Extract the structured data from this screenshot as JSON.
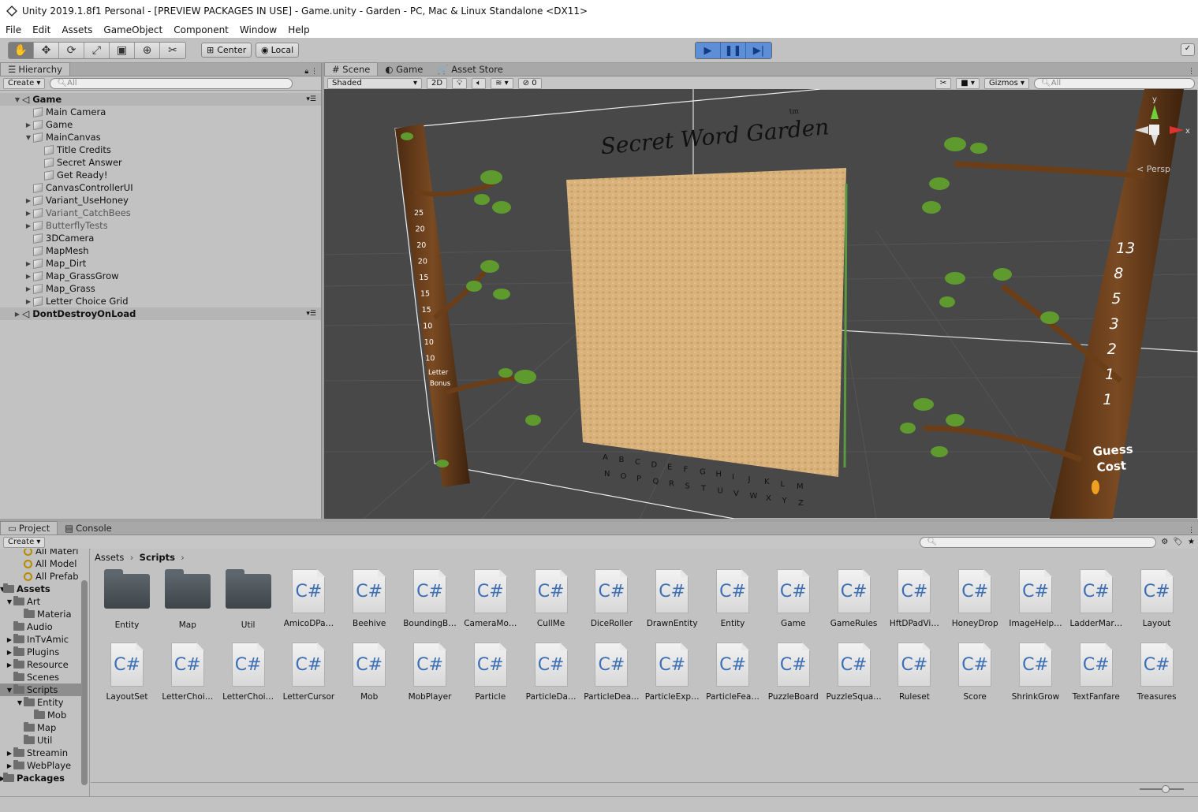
{
  "window": {
    "title": "Unity 2019.1.8f1 Personal - [PREVIEW PACKAGES IN USE] - Game.unity - Garden - PC, Mac & Linux Standalone <DX11>"
  },
  "menu": [
    "File",
    "Edit",
    "Assets",
    "GameObject",
    "Component",
    "Window",
    "Help"
  ],
  "toolbar": {
    "tools": [
      "hand-tool",
      "move-tool",
      "rotate-tool",
      "scale-tool",
      "rect-tool",
      "transform-tool",
      "custom-tool"
    ],
    "pivot_mode": "Center",
    "pivot_rotation": "Local"
  },
  "hierarchy": {
    "tab": "Hierarchy",
    "create": "Create",
    "search_placeholder": "All",
    "items": [
      {
        "label": "Game",
        "indent": 0,
        "arrow": "down",
        "scene": true
      },
      {
        "label": "Main Camera",
        "indent": 1,
        "arrow": ""
      },
      {
        "label": "Game",
        "indent": 1,
        "arrow": "right"
      },
      {
        "label": "MainCanvas",
        "indent": 1,
        "arrow": "down"
      },
      {
        "label": "Title Credits",
        "indent": 2,
        "arrow": ""
      },
      {
        "label": "Secret Answer",
        "indent": 2,
        "arrow": ""
      },
      {
        "label": "Get Ready!",
        "indent": 2,
        "arrow": ""
      },
      {
        "label": "CanvasControllerUI",
        "indent": 1,
        "arrow": ""
      },
      {
        "label": "Variant_UseHoney",
        "indent": 1,
        "arrow": "right"
      },
      {
        "label": "Variant_CatchBees",
        "indent": 1,
        "arrow": "right",
        "dim": true
      },
      {
        "label": "ButterflyTests",
        "indent": 1,
        "arrow": "right",
        "dim": true
      },
      {
        "label": "3DCamera",
        "indent": 1,
        "arrow": ""
      },
      {
        "label": "MapMesh",
        "indent": 1,
        "arrow": ""
      },
      {
        "label": "Map_Dirt",
        "indent": 1,
        "arrow": "right"
      },
      {
        "label": "Map_GrassGrow",
        "indent": 1,
        "arrow": "right"
      },
      {
        "label": "Map_Grass",
        "indent": 1,
        "arrow": "right"
      },
      {
        "label": "Letter Choice Grid",
        "indent": 1,
        "arrow": "right"
      },
      {
        "label": "DontDestroyOnLoad",
        "indent": 0,
        "arrow": "right",
        "scene": true
      }
    ]
  },
  "scene_tabs": [
    {
      "label": "Scene",
      "icon": "#"
    },
    {
      "label": "Game",
      "icon": "◐"
    },
    {
      "label": "Asset Store",
      "icon": "🛒"
    }
  ],
  "scene_toolbar": {
    "shading": "Shaded",
    "mode_2d": "2D",
    "hidden_count": "0",
    "gizmos": "Gizmos",
    "search_placeholder": "All"
  },
  "scene": {
    "title": "Secret Word Garden",
    "trademark": "tm",
    "left_scores": [
      "25",
      "20",
      "20",
      "20",
      "15",
      "15",
      "15",
      "10",
      "10",
      "10"
    ],
    "left_caption": [
      "Letter",
      "Bonus"
    ],
    "right_costs": [
      "13",
      "8",
      "5",
      "3",
      "2",
      "1",
      "1"
    ],
    "right_caption": [
      "Guess",
      "Cost"
    ],
    "letters_row1": [
      "A",
      "B",
      "C",
      "D",
      "E",
      "F",
      "G",
      "H",
      "I",
      "J",
      "K",
      "L",
      "M"
    ],
    "letters_row2": [
      "N",
      "O",
      "P",
      "Q",
      "R",
      "S",
      "T",
      "U",
      "V",
      "W",
      "X",
      "Y",
      "Z"
    ],
    "gizmo": {
      "x": "x",
      "y": "y",
      "persp": "< Persp"
    }
  },
  "project": {
    "tabs": [
      "Project",
      "Console"
    ],
    "create": "Create",
    "breadcrumb": [
      "Assets",
      "Scripts"
    ],
    "tree": [
      {
        "label": "All Materi",
        "indent": 2,
        "icon": "search",
        "arrow": ""
      },
      {
        "label": "All Model",
        "indent": 2,
        "icon": "search",
        "arrow": ""
      },
      {
        "label": "All Prefab",
        "indent": 2,
        "icon": "search",
        "arrow": ""
      },
      {
        "label": "Assets",
        "indent": 0,
        "icon": "folder",
        "arrow": "down",
        "bold": true
      },
      {
        "label": "Art",
        "indent": 1,
        "icon": "folder",
        "arrow": "down"
      },
      {
        "label": "Materia",
        "indent": 2,
        "icon": "folder",
        "arrow": ""
      },
      {
        "label": "Audio",
        "indent": 1,
        "icon": "folder",
        "arrow": ""
      },
      {
        "label": "InTvAmic",
        "indent": 1,
        "icon": "folder",
        "arrow": "right"
      },
      {
        "label": "Plugins",
        "indent": 1,
        "icon": "folder",
        "arrow": "right"
      },
      {
        "label": "Resource",
        "indent": 1,
        "icon": "folder",
        "arrow": "right"
      },
      {
        "label": "Scenes",
        "indent": 1,
        "icon": "folder",
        "arrow": ""
      },
      {
        "label": "Scripts",
        "indent": 1,
        "icon": "folder",
        "arrow": "down",
        "selected": true
      },
      {
        "label": "Entity",
        "indent": 2,
        "icon": "folder",
        "arrow": "down"
      },
      {
        "label": "Mob",
        "indent": 3,
        "icon": "folder",
        "arrow": ""
      },
      {
        "label": "Map",
        "indent": 2,
        "icon": "folder",
        "arrow": ""
      },
      {
        "label": "Util",
        "indent": 2,
        "icon": "folder",
        "arrow": ""
      },
      {
        "label": "Streamin",
        "indent": 1,
        "icon": "folder",
        "arrow": "right"
      },
      {
        "label": "WebPlaye",
        "indent": 1,
        "icon": "folder",
        "arrow": "right"
      },
      {
        "label": "Packages",
        "indent": 0,
        "icon": "folder",
        "arrow": "right",
        "bold": true
      }
    ],
    "assets": [
      {
        "label": "Entity",
        "type": "folder"
      },
      {
        "label": "Map",
        "type": "folder"
      },
      {
        "label": "Util",
        "type": "folder"
      },
      {
        "label": "AmicoDPa…",
        "type": "cs"
      },
      {
        "label": "Beehive",
        "type": "cs"
      },
      {
        "label": "BoundingB…",
        "type": "cs"
      },
      {
        "label": "CameraMo…",
        "type": "cs"
      },
      {
        "label": "CullMe",
        "type": "cs"
      },
      {
        "label": "DiceRoller",
        "type": "cs"
      },
      {
        "label": "DrawnEntity",
        "type": "cs"
      },
      {
        "label": "Entity",
        "type": "cs"
      },
      {
        "label": "Game",
        "type": "cs"
      },
      {
        "label": "GameRules",
        "type": "cs"
      },
      {
        "label": "HftDPadVi…",
        "type": "cs"
      },
      {
        "label": "HoneyDrop",
        "type": "cs"
      },
      {
        "label": "ImageHelp…",
        "type": "cs"
      },
      {
        "label": "LadderMar…",
        "type": "cs"
      },
      {
        "label": "Layout",
        "type": "cs"
      },
      {
        "label": "LayoutSet",
        "type": "cs"
      },
      {
        "label": "LetterChoi…",
        "type": "cs"
      },
      {
        "label": "LetterChoi…",
        "type": "cs"
      },
      {
        "label": "LetterCursor",
        "type": "cs"
      },
      {
        "label": "Mob",
        "type": "cs"
      },
      {
        "label": "MobPlayer",
        "type": "cs"
      },
      {
        "label": "Particle",
        "type": "cs"
      },
      {
        "label": "ParticleDa…",
        "type": "cs"
      },
      {
        "label": "ParticleDea…",
        "type": "cs"
      },
      {
        "label": "ParticleExp…",
        "type": "cs"
      },
      {
        "label": "ParticleFea…",
        "type": "cs"
      },
      {
        "label": "PuzzleBoard",
        "type": "cs"
      },
      {
        "label": "PuzzleSqua…",
        "type": "cs"
      },
      {
        "label": "Ruleset",
        "type": "cs"
      },
      {
        "label": "Score",
        "type": "cs"
      },
      {
        "label": "ShrinkGrow",
        "type": "cs"
      },
      {
        "label": "TextFanfare",
        "type": "cs"
      },
      {
        "label": "Treasures",
        "type": "cs"
      }
    ],
    "cs_glyph": "C#"
  }
}
